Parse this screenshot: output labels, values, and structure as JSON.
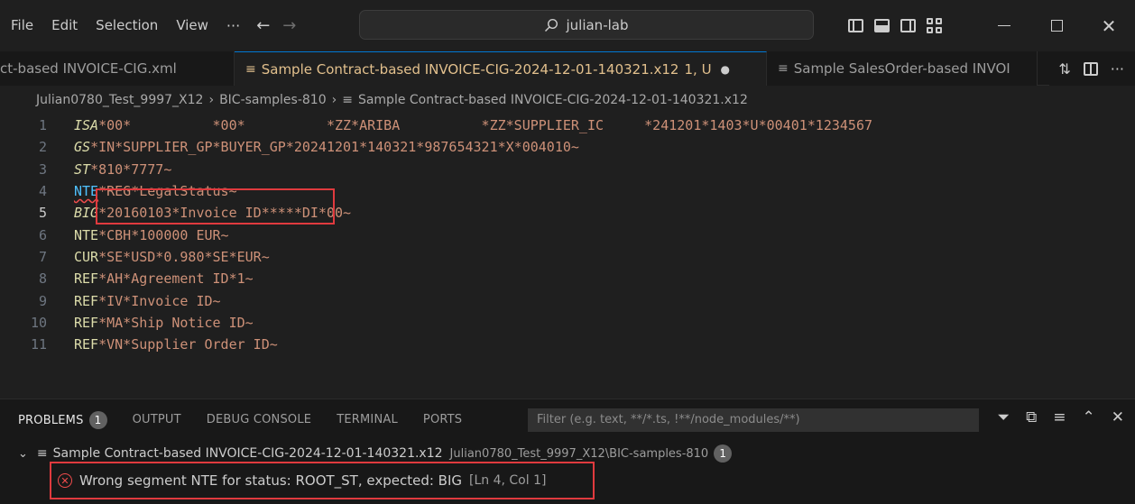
{
  "menu": [
    "File",
    "Edit",
    "Selection",
    "View"
  ],
  "menu_more": "···",
  "search_text": "julian-lab",
  "tabs": [
    {
      "label": "ct-based INVOICE-CIG.xml",
      "active": false
    },
    {
      "label": "Sample Contract-based INVOICE-CIG-2024-12-01-140321.x12",
      "badge": "1, U",
      "active": true
    },
    {
      "label": "Sample SalesOrder-based INVOI",
      "active": false
    }
  ],
  "breadcrumb": [
    "Julian0780_Test_9997_X12",
    "BIC-samples-810",
    "Sample Contract-based INVOICE-CIG-2024-12-01-140321.x12"
  ],
  "code_lines": [
    {
      "n": "1",
      "seg": "ISA",
      "rest": "*00*          *00*          *ZZ*ARIBA          *ZZ*SUPPLIER_IC     *241201*1403*U*00401*1234567"
    },
    {
      "n": "2",
      "seg": "GS",
      "rest": "*IN*SUPPLIER_GP*BUYER_GP*20241201*140321*987654321*X*004010~"
    },
    {
      "n": "3",
      "seg": "ST",
      "rest": "*810*7777~"
    },
    {
      "n": "4",
      "seg": "NTE",
      "rest": "*REG*LegalStatus~"
    },
    {
      "n": "5",
      "seg": "BIG",
      "rest": "*20160103*Invoice ID*****DI*00~"
    },
    {
      "n": "6",
      "seg": "NTE",
      "rest": "*CBH*100000 EUR~"
    },
    {
      "n": "7",
      "seg": "CUR",
      "rest": "*SE*USD*0.980*SE*EUR~"
    },
    {
      "n": "8",
      "seg": "REF",
      "rest": "*AH*Agreement ID*1~"
    },
    {
      "n": "9",
      "seg": "REF",
      "rest": "*IV*Invoice ID~"
    },
    {
      "n": "10",
      "seg": "REF",
      "rest": "*MA*Ship Notice ID~"
    },
    {
      "n": "11",
      "seg": "REF",
      "rest": "*VN*Supplier Order ID~"
    }
  ],
  "panel": {
    "tabs": [
      "PROBLEMS",
      "OUTPUT",
      "DEBUG CONSOLE",
      "TERMINAL",
      "PORTS"
    ],
    "problems_count": "1",
    "filter_placeholder": "Filter (e.g. text, **/*.ts, !**/node_modules/**)",
    "file_name": "Sample Contract-based INVOICE-CIG-2024-12-01-140321.x12",
    "file_path": "Julian0780_Test_9997_X12\\BIC-samples-810",
    "file_count": "1",
    "error_message": "Wrong segment NTE for status: ROOT_ST, expected: BIG",
    "error_location": "[Ln 4, Col 1]"
  },
  "colors": {
    "accent": "#0078d4",
    "error": "#f14c4c",
    "highlight_box": "#e03a3e"
  }
}
